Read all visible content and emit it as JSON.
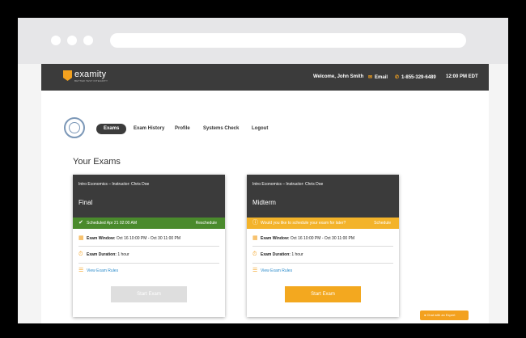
{
  "header": {
    "logo_name": "examity",
    "logo_tagline": "BETTER TEST INTEGRITY",
    "welcome": "Welcome, John Smith",
    "email_label": "Email",
    "phone": "1-855-329-6489",
    "time": "12:00 PM EDT"
  },
  "nav": {
    "items": [
      "Exams",
      "Exam History",
      "Profile",
      "Systems Check",
      "Logout"
    ],
    "active": "Exams"
  },
  "page_title": "Your Exams",
  "exams": [
    {
      "course": "Intro Economics – Instructor: Chris Doe",
      "name": "Final",
      "status_text": "Scheduled Apr 21 02:00 AM",
      "status_action": "Reschedule",
      "status_color": "#4a8a2c",
      "window_label": "Exam Window:",
      "window_value": "Oct 16 10:00 PM - Oct 30 11:00 PM",
      "duration_label": "Exam Duration:",
      "duration_value": "1 hour",
      "rules_link": "View Exam Rules",
      "start_label": "Start Exam",
      "start_enabled": false
    },
    {
      "course": "Intro Economics – Instructor: Chris Doe",
      "name": "Midterm",
      "status_text": "Would you like to schedule your exam for later?",
      "status_action": "Schedule",
      "status_color": "#f3b32a",
      "window_label": "Exam Window:",
      "window_value": "Oct 16 10:00 PM - Oct 30 11:00 PM",
      "duration_label": "Exam Duration:",
      "duration_value": "1 hour",
      "rules_link": "View Exam Rules",
      "start_label": "Start Exam",
      "start_enabled": true
    }
  ],
  "chat": {
    "label": "Chat with an Expert"
  },
  "colors": {
    "accent": "#f3a11f",
    "topbar": "#3b3b3b",
    "link": "#2d8ccb"
  }
}
